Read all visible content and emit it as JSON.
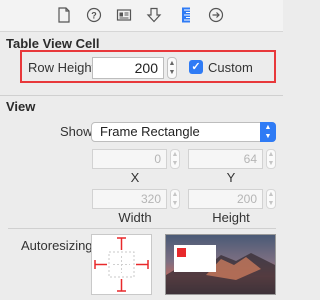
{
  "toolbar": {
    "icons": [
      "file-icon",
      "help-icon",
      "identity-icon",
      "attributes-icon",
      "size-icon",
      "connections-icon"
    ],
    "active": "size-icon"
  },
  "table_view_cell": {
    "title": "Table View Cell",
    "row_height_label": "Row Height",
    "row_height_value": "200",
    "custom_label": "Custom",
    "custom_checked": true
  },
  "view": {
    "title": "View",
    "show_label": "Show",
    "show_value": "Frame Rectangle",
    "x_value": "0",
    "y_value": "64",
    "x_label": "X",
    "y_label": "Y",
    "width_value": "320",
    "height_value": "200",
    "width_label": "Width",
    "height_label": "Height",
    "autoresizing_label": "Autoresizing"
  },
  "colors": {
    "accent": "#2f7bf5",
    "highlight": "#e8383b",
    "autoresize_red": "#e8292b"
  }
}
